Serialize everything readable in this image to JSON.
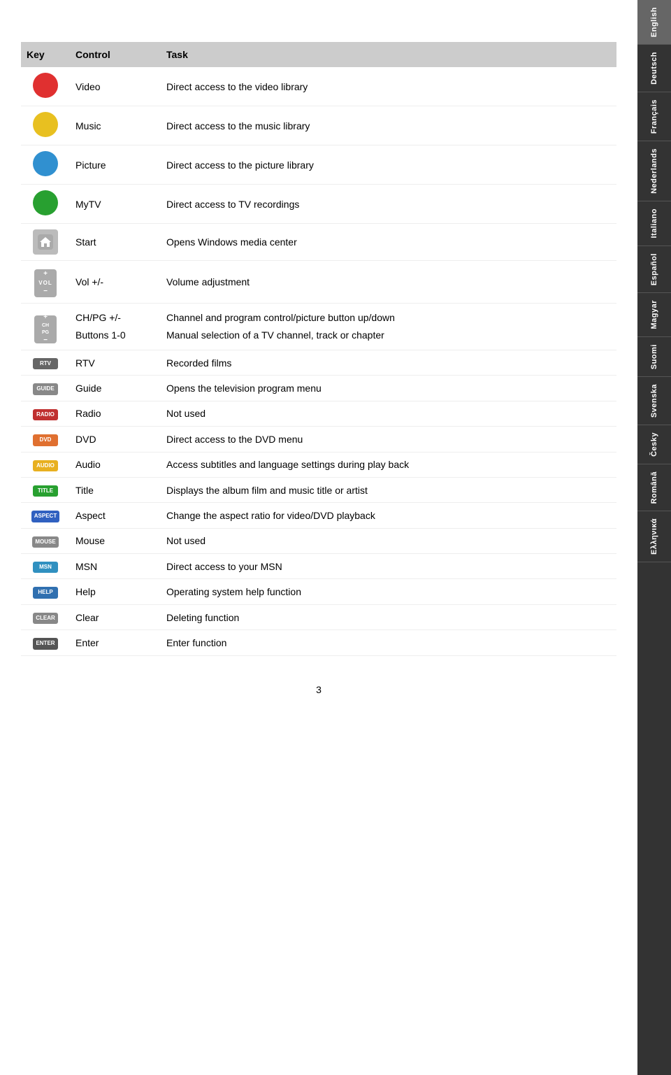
{
  "languages": [
    {
      "label": "English",
      "active": true
    },
    {
      "label": "Deutsch",
      "active": false
    },
    {
      "label": "Français",
      "active": false
    },
    {
      "label": "Nederlands",
      "active": false
    },
    {
      "label": "Italiano",
      "active": false
    },
    {
      "label": "Español",
      "active": false
    },
    {
      "label": "Magyar",
      "active": false
    },
    {
      "label": "Suomi",
      "active": false
    },
    {
      "label": "Svenska",
      "active": false
    },
    {
      "label": "Česky",
      "active": false
    },
    {
      "label": "Română",
      "active": false
    },
    {
      "label": "Ελληνικά",
      "active": false
    }
  ],
  "table": {
    "headers": {
      "key": "Key",
      "control": "Control",
      "task": "Task"
    },
    "rows": [
      {
        "key_type": "circle",
        "key_color": "#e03030",
        "control": "Video",
        "task": "Direct access to the video library"
      },
      {
        "key_type": "circle",
        "key_color": "#e8c020",
        "control": "Music",
        "task": "Direct access to the music library"
      },
      {
        "key_type": "circle",
        "key_color": "#3090d0",
        "control": "Picture",
        "task": "Direct access to the picture library"
      },
      {
        "key_type": "circle",
        "key_color": "#28a030",
        "control": "MyTV",
        "task": "Direct access to TV recordings"
      },
      {
        "key_type": "house",
        "control": "Start",
        "task": "Opens Windows media center"
      },
      {
        "key_type": "vol",
        "control": "Vol +/-",
        "task": "Volume adjustment"
      },
      {
        "key_type": "chpg",
        "control": "CH/PG +/-\nButtons 1-0",
        "task": "Channel and program control/picture button up/down\nManual selection of a TV channel, track or chapter"
      },
      {
        "key_type": "badge",
        "key_label": "RTV",
        "key_color": "#666",
        "control": "RTV",
        "task": "Recorded films"
      },
      {
        "key_type": "badge",
        "key_label": "GUIDE",
        "key_color": "#888",
        "control": "Guide",
        "task": "Opens the television program menu"
      },
      {
        "key_type": "badge",
        "key_label": "RADIO",
        "key_color": "#c03030",
        "control": "Radio",
        "task": "Not used"
      },
      {
        "key_type": "badge",
        "key_label": "DVD",
        "key_color": "#e07030",
        "control": "DVD",
        "task": "Direct access to the DVD menu"
      },
      {
        "key_type": "badge",
        "key_label": "AUDIO",
        "key_color": "#e8b020",
        "control": "Audio",
        "task": "Access subtitles and language settings during play back"
      },
      {
        "key_type": "badge",
        "key_label": "TITLE",
        "key_color": "#28a030",
        "control": "Title",
        "task": "Displays the album film and music title or artist"
      },
      {
        "key_type": "badge",
        "key_label": "ASPECT",
        "key_color": "#3060c0",
        "control": "Aspect",
        "task": "Change the aspect ratio for video/DVD playback"
      },
      {
        "key_type": "badge",
        "key_label": "MOUSE",
        "key_color": "#888",
        "control": "Mouse",
        "task": "Not used"
      },
      {
        "key_type": "badge",
        "key_label": "MSN",
        "key_color": "#3090c0",
        "control": "MSN",
        "task": "Direct access to your MSN"
      },
      {
        "key_type": "badge",
        "key_label": "HELP",
        "key_color": "#3070b0",
        "control": "Help",
        "task": "Operating system help function"
      },
      {
        "key_type": "badge",
        "key_label": "CLEAR",
        "key_color": "#888",
        "control": "Clear",
        "task": "Deleting function"
      },
      {
        "key_type": "badge",
        "key_label": "ENTER",
        "key_color": "#555",
        "control": "Enter",
        "task": "Enter function"
      }
    ]
  },
  "page_number": "3"
}
